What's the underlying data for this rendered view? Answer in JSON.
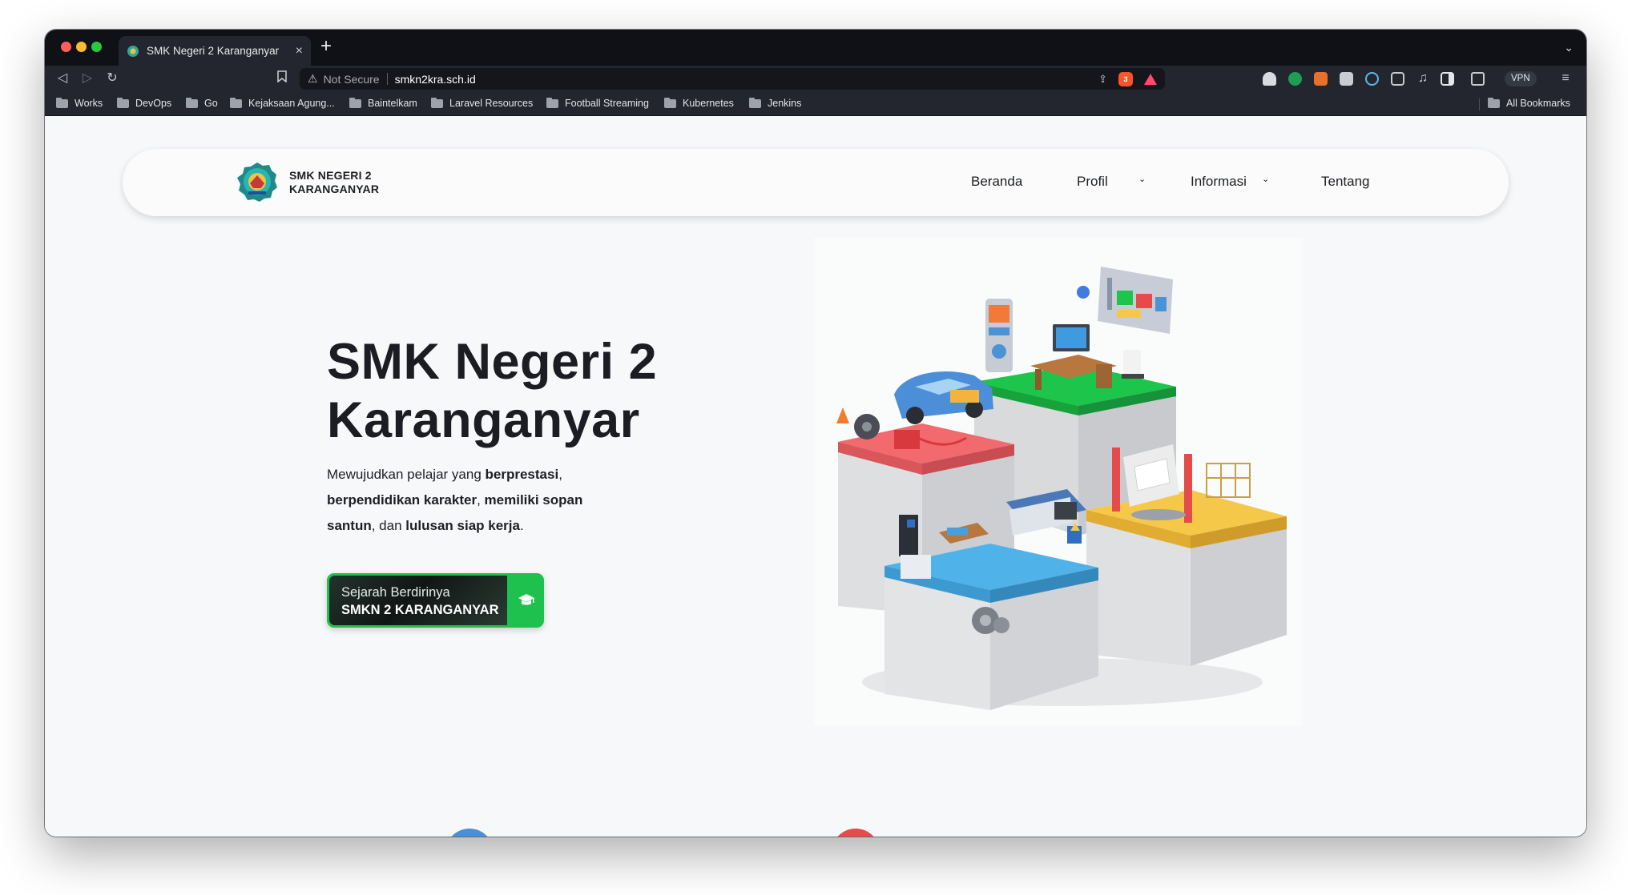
{
  "browser": {
    "tab_title": "SMK Negeri 2 Karanganyar",
    "tab_close": "×",
    "new_tab": "+",
    "url_security": "Not Secure",
    "url_host": "smkn2kra.sch.id",
    "brave_shield_count": "3",
    "vpn_label": "VPN",
    "bookmarks": [
      "Works",
      "DevOps",
      "Go",
      "Kejaksaan Agung...",
      "Baintelkam",
      "Laravel Resources",
      "Football Streaming",
      "Kubernetes",
      "Jenkins"
    ],
    "all_bookmarks": "All Bookmarks"
  },
  "navbar": {
    "logo_line1": "SMK NEGERI 2",
    "logo_line2": "KARANGANYAR",
    "items": [
      {
        "label": "Beranda"
      },
      {
        "label": "Profil"
      },
      {
        "label": "Informasi"
      },
      {
        "label": "Tentang"
      }
    ]
  },
  "hero": {
    "title_line1": "SMK Negeri 2",
    "title_line2": "Karanganyar",
    "desc": {
      "p1": "Mewujudkan pelajar yang ",
      "b1": "berprestasi",
      "p2": ", ",
      "b2": "berpendidikan karakter",
      "p3": ", ",
      "b3": "memiliki sopan santun",
      "p4": ", dan ",
      "b4": "lulusan siap kerja",
      "p5": "."
    },
    "cta_line1": "Sejarah Berdirinya",
    "cta_line2": "SMKN 2 KARANGANYAR"
  },
  "colors": {
    "accent_green": "#1fc14e",
    "red_block": "#f26a6e",
    "green_block": "#1dc54a",
    "blue_block": "#4fb3ea",
    "yellow_block": "#f5c84a"
  }
}
